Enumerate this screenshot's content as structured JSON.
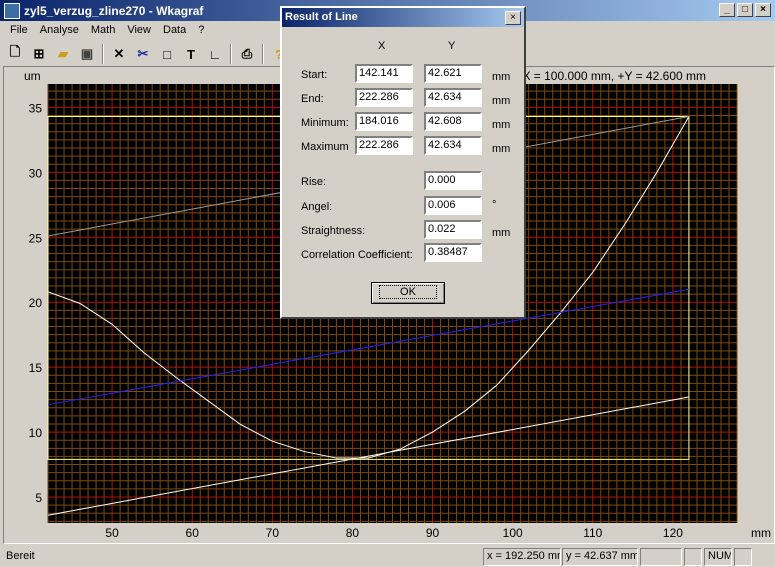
{
  "window": {
    "title": "zyl5_verzug_zline270 - Wkagraf",
    "minimize": "_",
    "maximize": "□",
    "close": "×"
  },
  "menu": [
    "File",
    "Analyse",
    "Math",
    "View",
    "Data",
    "?"
  ],
  "toolbar": [
    "new-icon",
    "add-icon",
    "open-icon",
    "save-icon",
    "cut-line-icon",
    "scissors-icon",
    "rectangle-icon",
    "text-icon",
    "axis-icon",
    "print-icon",
    "help-icon"
  ],
  "plot": {
    "info": "+X = 100.000 mm, +Y = 42.600 mm",
    "colors": {
      "background": "#000000",
      "grid_minor": "#7a4a10",
      "grid_major": "#b01010",
      "frame": "#ffff99",
      "curve": "#ffffff",
      "gray_line": "#9a9a9a",
      "blue_line": "#2020ff"
    }
  },
  "chart_data": {
    "type": "line",
    "xlabel": "mm",
    "ylabel": "um",
    "xlim": [
      42,
      128
    ],
    "ylim": [
      3,
      36.8
    ],
    "xticks": [
      50,
      60,
      70,
      80,
      90,
      100,
      110,
      120
    ],
    "yticks": [
      5,
      10,
      15,
      20,
      25,
      30,
      35
    ],
    "grid": true,
    "series": [
      {
        "role": "profile",
        "color": "#ffffff",
        "x": [
          42,
          46,
          50,
          54,
          58,
          62,
          66,
          70,
          74,
          78,
          82,
          86,
          90,
          94,
          98,
          102,
          106,
          110,
          114,
          118,
          122
        ],
        "y": [
          20.8,
          19.9,
          18.3,
          16.1,
          14.2,
          12.4,
          10.6,
          9.3,
          8.5,
          8,
          8,
          8.7,
          10,
          11.6,
          13.6,
          16.3,
          19.2,
          22.3,
          26,
          30,
          34.3
        ]
      },
      {
        "role": "frame",
        "color": "#ffff99",
        "x": [
          42,
          122,
          122,
          42
        ],
        "y": [
          34.3,
          34.3,
          7.9,
          7.9
        ]
      },
      {
        "role": "gray-line",
        "color": "#9a9a9a",
        "x": [
          42,
          122
        ],
        "y": [
          25.1,
          34.3
        ]
      },
      {
        "role": "blue-line",
        "color": "#2020ff",
        "x": [
          42,
          122
        ],
        "y": [
          12.1,
          21
        ]
      },
      {
        "role": "lower-line",
        "color": "#ffffff",
        "x": [
          42,
          122
        ],
        "y": [
          3.6,
          12.7
        ]
      }
    ]
  },
  "dialog": {
    "title": "Result of Line",
    "col_x": "X",
    "col_y": "Y",
    "unit": "mm",
    "degree": "°",
    "rows": [
      {
        "label": "Start:",
        "x": "142.141",
        "y": "42.621"
      },
      {
        "label": "End:",
        "x": "222.286",
        "y": "42.634"
      },
      {
        "label": "Minimum:",
        "x": "184.016",
        "y": "42.608"
      },
      {
        "label": "Maximum",
        "x": "222.286",
        "y": "42.634"
      }
    ],
    "rise_label": "Rise:",
    "rise": "0.000",
    "angel_label": "Angel:",
    "angel": "0.006",
    "straightness_label": "Straightness:",
    "straightness": "0.022",
    "corr_label": "Correlation Coefficient:",
    "corr": "0.38487",
    "ok": "OK"
  },
  "status": {
    "text": "Bereit",
    "x": "x = 192.250 mm",
    "y": "y = 42.637 mm",
    "num": "NUM"
  }
}
